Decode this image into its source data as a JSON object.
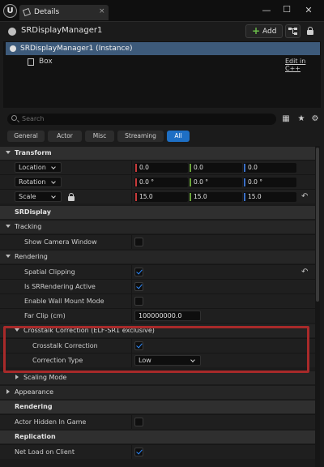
{
  "window": {
    "logo": "U",
    "tab_title": "Details",
    "tab_close": "×",
    "controls": {
      "minimize": "—",
      "maximize": "☐",
      "close": "✕"
    }
  },
  "header": {
    "actor_name": "SRDisplayManager1",
    "add_label": "Add",
    "add_symbol": "+"
  },
  "components": {
    "selected_label": "SRDisplayManager1 (Instance)",
    "child_label": "Box",
    "edit_link": "Edit in C++"
  },
  "search": {
    "placeholder": "Search"
  },
  "toolbar_icons": [
    "table-view-icon",
    "favorites-star-icon",
    "settings-gear-icon"
  ],
  "toolbar_glyphs": {
    "table": "▦",
    "star": "★",
    "gear": "⚙"
  },
  "filters": [
    {
      "label": "General",
      "active": false
    },
    {
      "label": "Actor",
      "active": false
    },
    {
      "label": "Misc",
      "active": false
    },
    {
      "label": "Streaming",
      "active": false
    },
    {
      "label": "All",
      "active": true
    }
  ],
  "transform": {
    "title": "Transform",
    "location": {
      "label": "Location",
      "x": "0.0",
      "y": "0.0",
      "z": "0.0"
    },
    "rotation": {
      "label": "Rotation",
      "x": "0.0 °",
      "y": "0.0 °",
      "z": "0.0 °"
    },
    "scale": {
      "label": "Scale",
      "x": "15.0",
      "y": "15.0",
      "z": "15.0"
    },
    "axis_colors": {
      "x": "#c73a3a",
      "y": "#6aa53a",
      "z": "#3a6fc7"
    }
  },
  "srdisplay": {
    "title": "SRDisplay",
    "tracking": {
      "title": "Tracking",
      "show_camera_window": {
        "label": "Show Camera Window",
        "checked": false
      }
    },
    "rendering": {
      "title": "Rendering",
      "spatial_clipping": {
        "label": "Spatial Clipping",
        "checked": true
      },
      "is_srrendering_active": {
        "label": "Is SRRendering Active",
        "checked": true
      },
      "enable_wall_mount_mode": {
        "label": "Enable Wall Mount Mode",
        "checked": false
      },
      "far_clip": {
        "label": "Far Clip (cm)",
        "value": "100000000.0"
      }
    },
    "crosstalk": {
      "title": "Crosstalk Correction (ELF-SR1 exclusive)",
      "enabled": {
        "label": "Crosstalk Correction",
        "checked": true
      },
      "type": {
        "label": "Correction Type",
        "value": "Low"
      }
    },
    "scaling_mode": {
      "title": "Scaling Mode"
    }
  },
  "appearance": {
    "title": "Appearance"
  },
  "rendering": {
    "title": "Rendering",
    "actor_hidden_in_game": {
      "label": "Actor Hidden In Game",
      "checked": false
    }
  },
  "replication": {
    "title": "Replication",
    "net_load_on_client": {
      "label": "Net Load on Client",
      "checked": true
    }
  },
  "reset_glyph": "↶"
}
